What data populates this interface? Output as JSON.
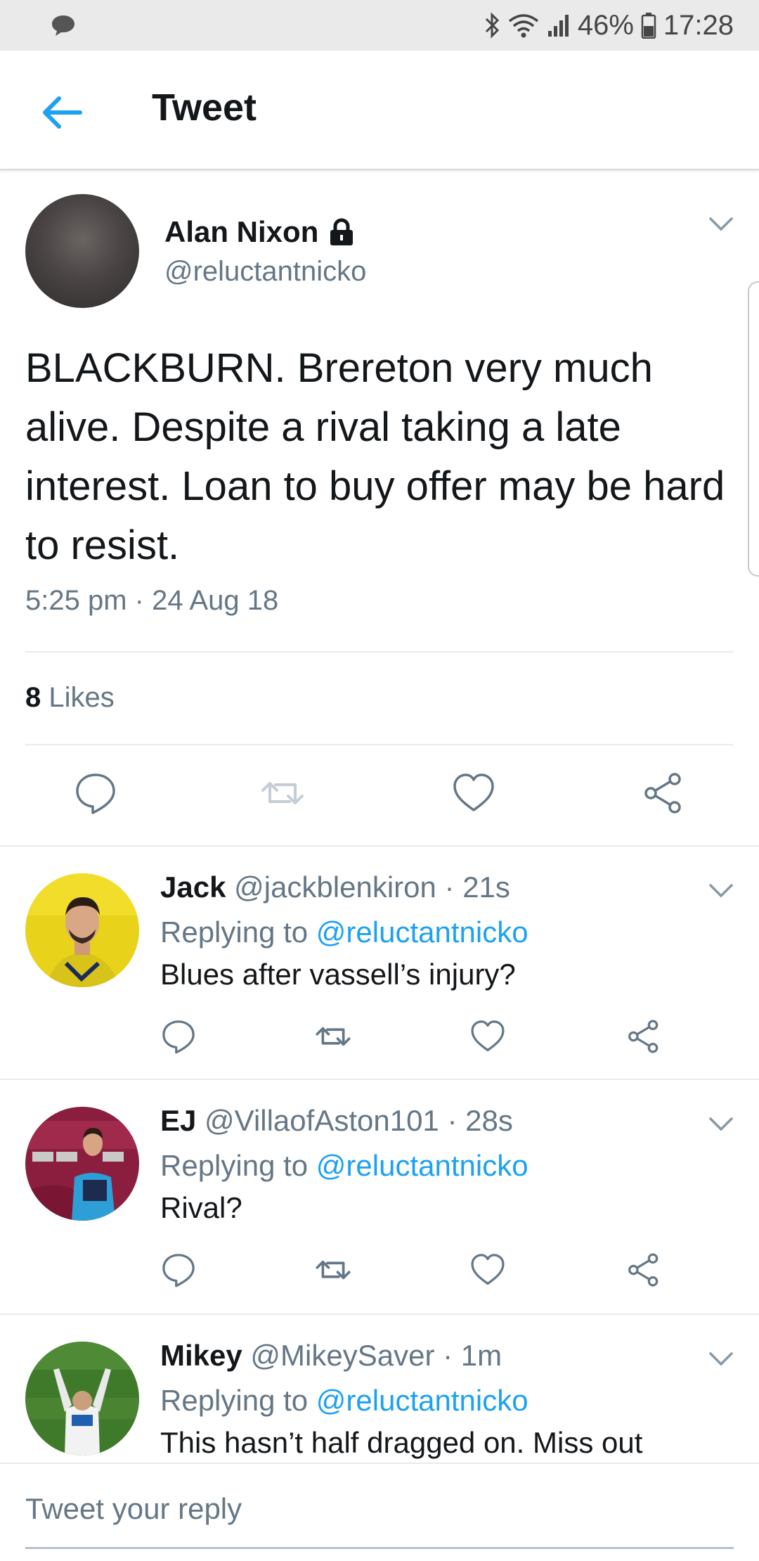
{
  "status_bar": {
    "battery": "46%",
    "time": "17:28",
    "icons": [
      "message-icon",
      "bluetooth-icon",
      "wifi-icon",
      "signal-icon",
      "battery-icon"
    ]
  },
  "app_bar": {
    "title": "Tweet",
    "back_icon": "back-arrow-icon"
  },
  "main_tweet": {
    "author_name": "Alan Nixon",
    "protected_icon": "lock-icon",
    "handle": "@reluctantnicko",
    "text": "BLACKBURN. Brereton very much alive. Despite a rival taking a late interest. Loan to buy offer may be hard to resist.",
    "timestamp": "5:25 pm · 24 Aug 18",
    "likes_count": "8",
    "likes_label": "Likes",
    "actions": [
      "reply-icon",
      "retweet-icon",
      "like-icon",
      "share-icon"
    ]
  },
  "replies": [
    {
      "name": "Jack",
      "handle": "@jackblenkiron",
      "time": "· 21s",
      "replying_prefix": "Replying to",
      "replying_to": "@reluctantnicko",
      "text": "Blues after vassell’s injury?"
    },
    {
      "name": "EJ",
      "handle": "@VillaofAston101",
      "time": "· 28s",
      "replying_prefix": "Replying to",
      "replying_to": "@reluctantnicko",
      "text": "Rival?"
    },
    {
      "name": "Mikey",
      "handle": "@MikeySaver",
      "time": "· 1m",
      "replying_prefix": "Replying to",
      "replying_to": "@reluctantnicko",
      "text": "This hasn’t half dragged on. Miss out"
    }
  ],
  "compose": {
    "placeholder": "Tweet your reply"
  },
  "colors": {
    "accent": "#1da1f2",
    "secondary_text": "#657786",
    "primary_text": "#14171a",
    "action_icon": "#657786"
  }
}
